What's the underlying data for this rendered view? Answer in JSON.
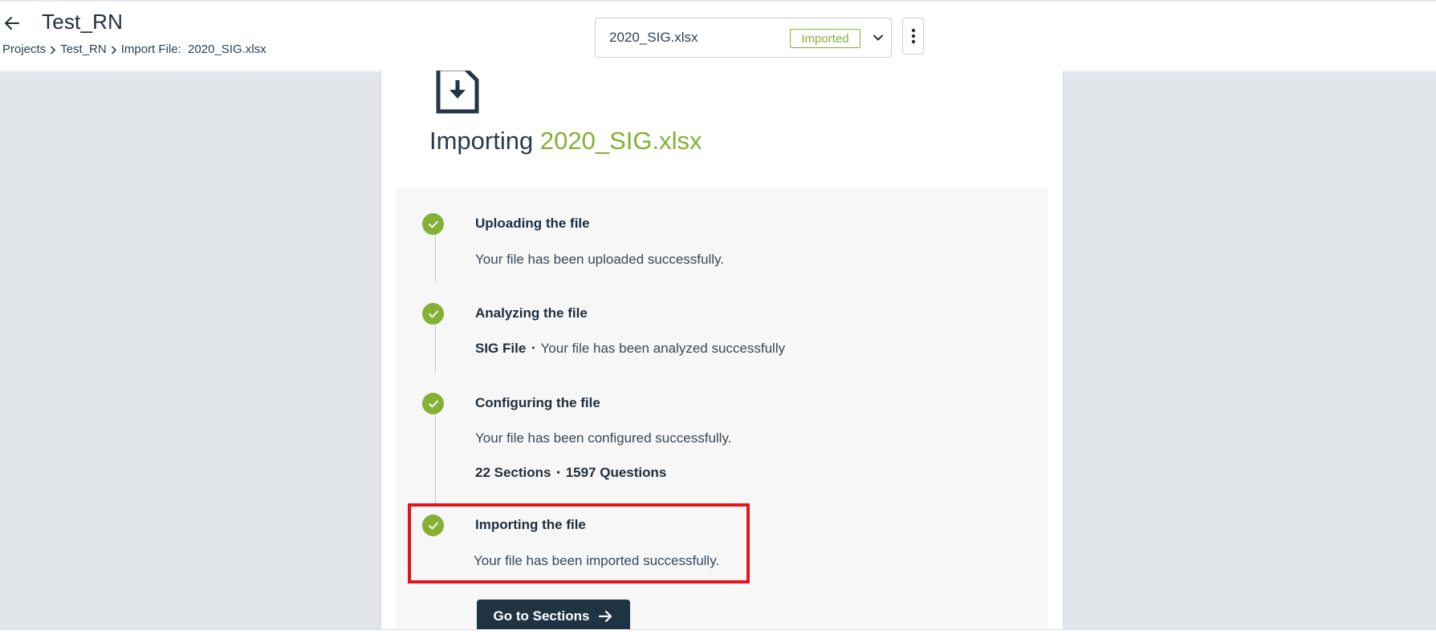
{
  "header": {
    "title": "Test_RN",
    "breadcrumb": [
      "Projects",
      "Test_RN",
      "Import File:  2020_SIG.xlsx"
    ],
    "file_select": {
      "selected": "2020_SIG.xlsx",
      "status": "Imported"
    }
  },
  "main": {
    "heading_prefix": "Importing",
    "heading_file": "2020_SIG.xlsx",
    "steps": [
      {
        "title": "Uploading the file",
        "text": "Your file has been uploaded successfully."
      },
      {
        "title": "Analyzing the file",
        "type_label": "SIG File",
        "text": "Your file has been analyzed successfully"
      },
      {
        "title": "Configuring the file",
        "text": "Your file has been configured successfully.",
        "sections": "22 Sections",
        "questions": "1597 Questions"
      },
      {
        "title": "Importing the file",
        "text": "Your file has been imported successfully."
      }
    ],
    "go_button_label": "Go to Sections"
  },
  "colors": {
    "accent_green": "#84b135",
    "primary_dark": "#1f3442",
    "highlight_red": "#e3141e",
    "page_bg": "#e2e5e9"
  },
  "icons": [
    "back-arrow-icon",
    "chevron-right-icon",
    "chevron-down-icon",
    "more-vertical-icon",
    "import-file-icon",
    "check-icon",
    "arrow-right-icon"
  ]
}
